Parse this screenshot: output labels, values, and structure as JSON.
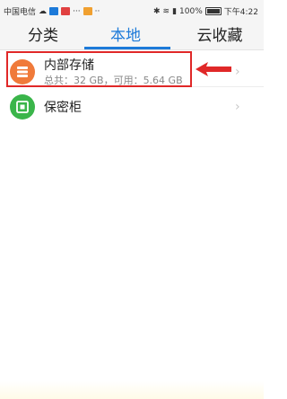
{
  "status_bar": {
    "carrier": "中国电信",
    "battery": "100%",
    "time": "下午4:22"
  },
  "tabs": [
    {
      "label": "分类",
      "active": false
    },
    {
      "label": "本地",
      "active": true
    },
    {
      "label": "云收藏",
      "active": false
    }
  ],
  "list": {
    "items": [
      {
        "title": "内部存储",
        "subtitle": "总共：32 GB，可用：5.64 GB",
        "icon": "storage-icon",
        "icon_color": "#f07a3a"
      },
      {
        "title": "保密柜",
        "icon": "safe-icon",
        "icon_color": "#3ab54a"
      }
    ]
  },
  "colors": {
    "accent": "#1d7ad9",
    "annotation": "#e02828"
  }
}
